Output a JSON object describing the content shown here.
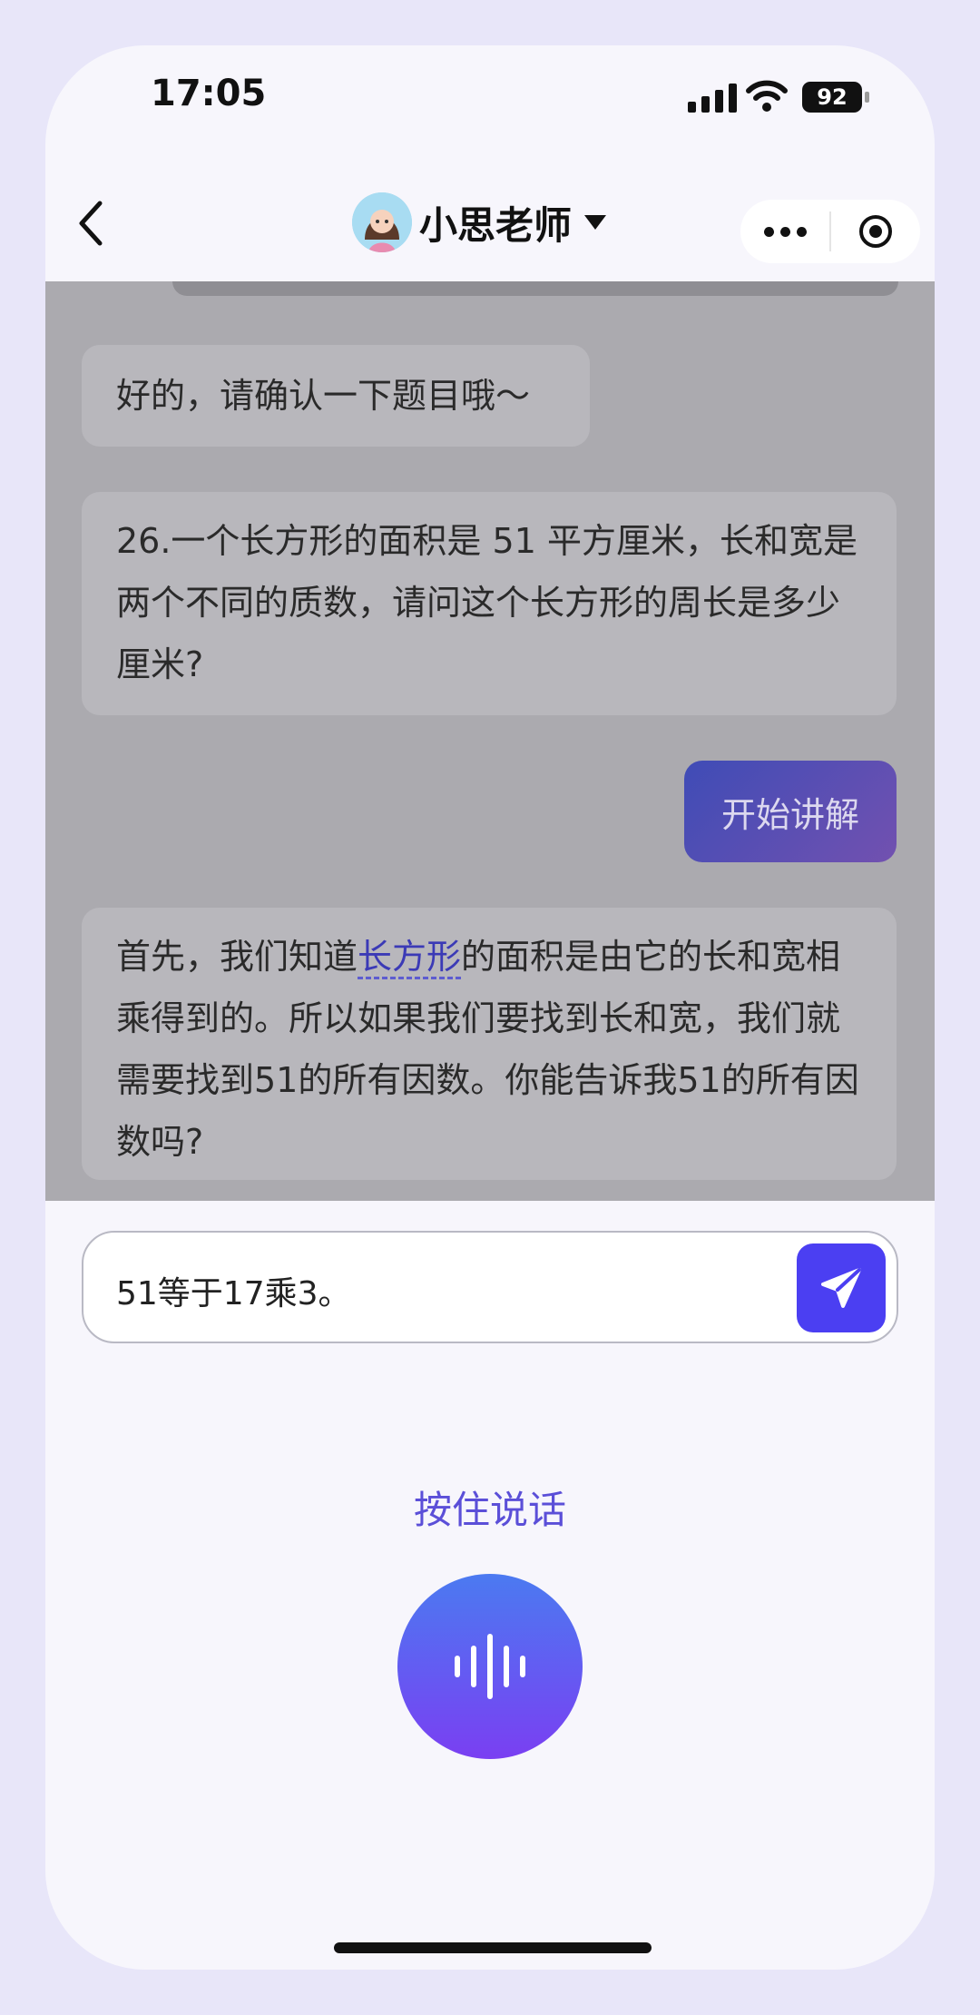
{
  "status_bar": {
    "time": "17:05",
    "battery": "92"
  },
  "nav": {
    "title": "小思老师"
  },
  "messages": [
    {
      "role": "assistant",
      "text": "好的，请确认一下题目哦～"
    },
    {
      "role": "assistant",
      "text": "26.一个长方形的面积是 51 平方厘米，长和宽是两个不同的质数，请问这个长方形的周长是多少厘米?"
    },
    {
      "role": "user",
      "text": "开始讲解"
    },
    {
      "role": "assistant",
      "text_before": "首先，我们知道",
      "highlight": "长方形",
      "text_after": "的面积是由它的长和宽相乘得到的。所以如果我们要找到长和宽，我们就需要找到51的所有因数。你能告诉我51的所有因数吗?"
    }
  ],
  "input": {
    "value": "51等于17乘3。"
  },
  "voice": {
    "hold_label": "按住说话"
  },
  "colors": {
    "accent": "#4b3ff2",
    "user_bubble": "#5a4fc0"
  }
}
